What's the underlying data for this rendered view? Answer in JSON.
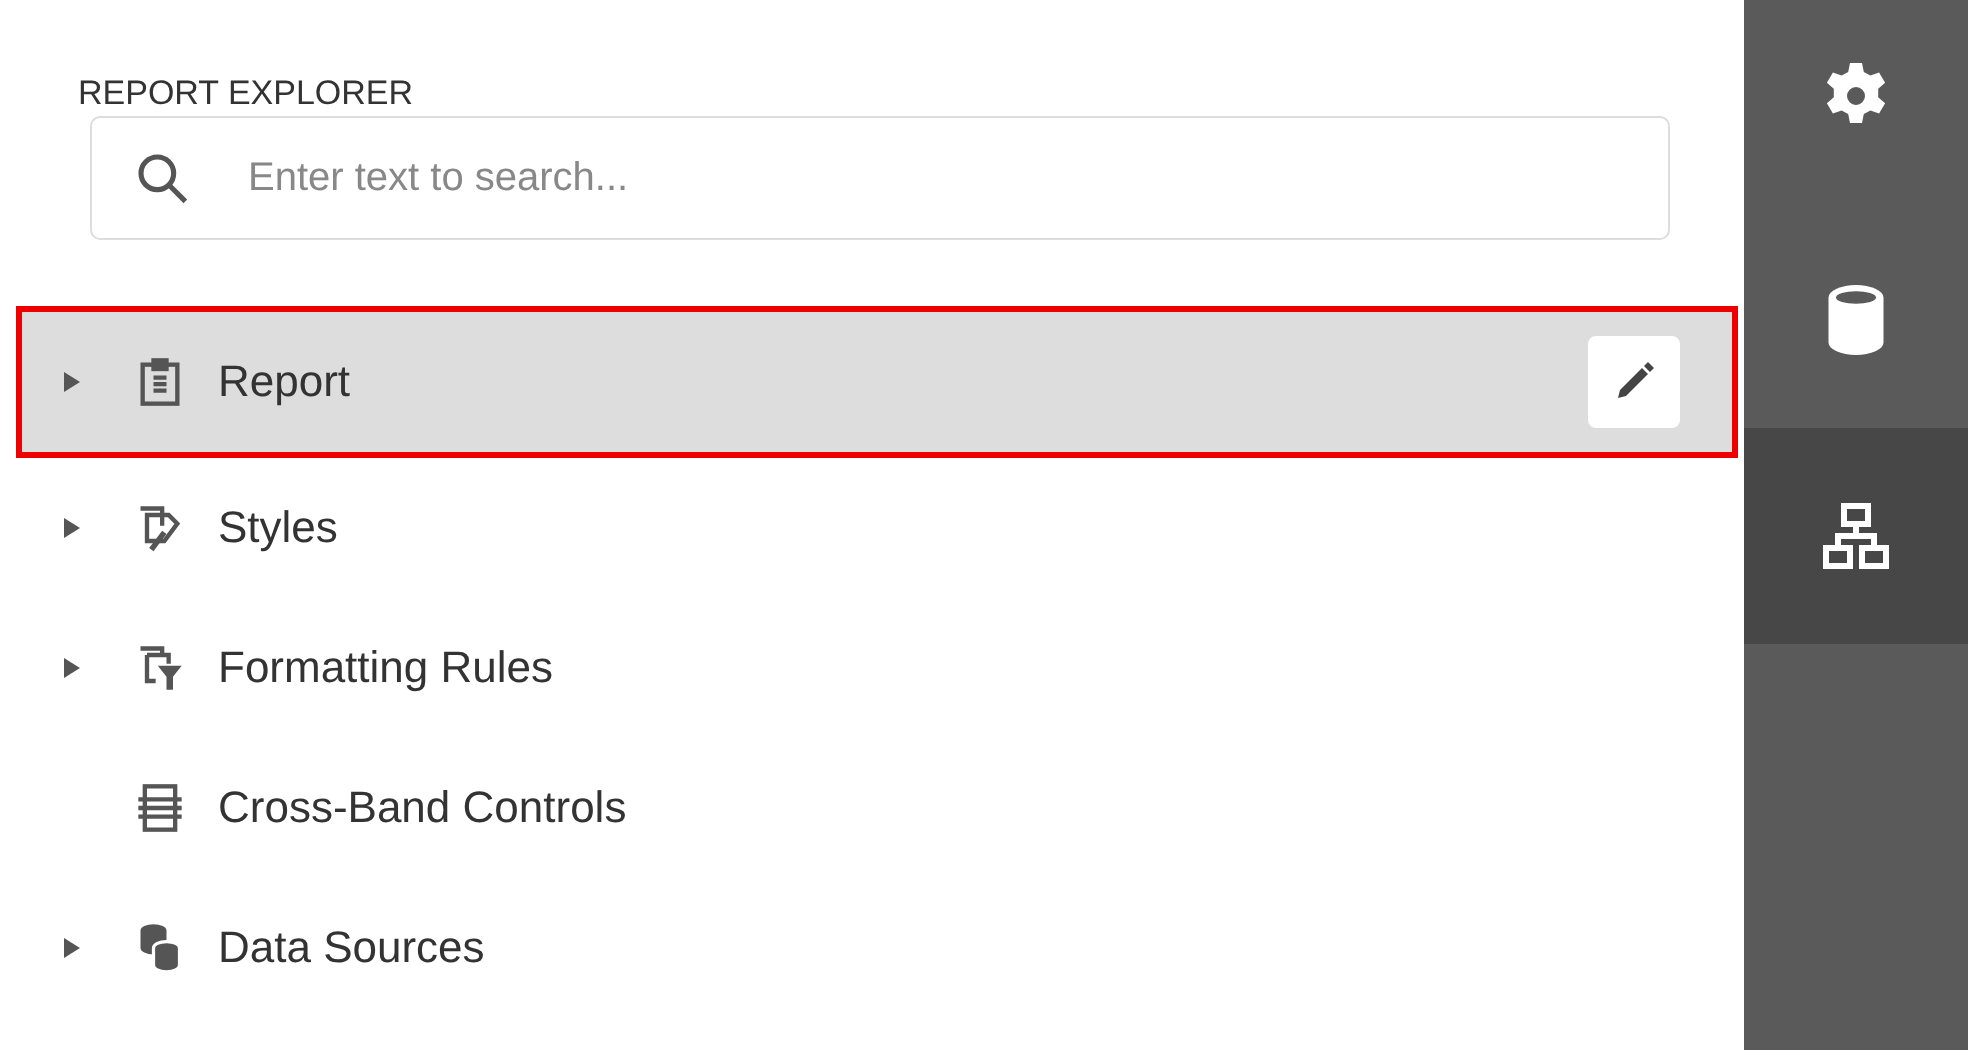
{
  "panel": {
    "title": "REPORT EXPLORER"
  },
  "search": {
    "placeholder": "Enter text to search..."
  },
  "tree": [
    {
      "label": "Report",
      "kind": "report",
      "expanded": false,
      "selected": true
    },
    {
      "label": "Styles",
      "kind": "styles",
      "expanded": false,
      "selected": false
    },
    {
      "label": "Formatting Rules",
      "kind": "rules",
      "expanded": false,
      "selected": false
    },
    {
      "label": "Cross-Band Controls",
      "kind": "crossband",
      "selected": false
    },
    {
      "label": "Data Sources",
      "kind": "datasources",
      "expanded": false,
      "selected": false
    }
  ],
  "side_tabs": [
    {
      "kind": "settings",
      "selected": false
    },
    {
      "kind": "database",
      "selected": false
    },
    {
      "kind": "explorer",
      "selected": true
    }
  ]
}
